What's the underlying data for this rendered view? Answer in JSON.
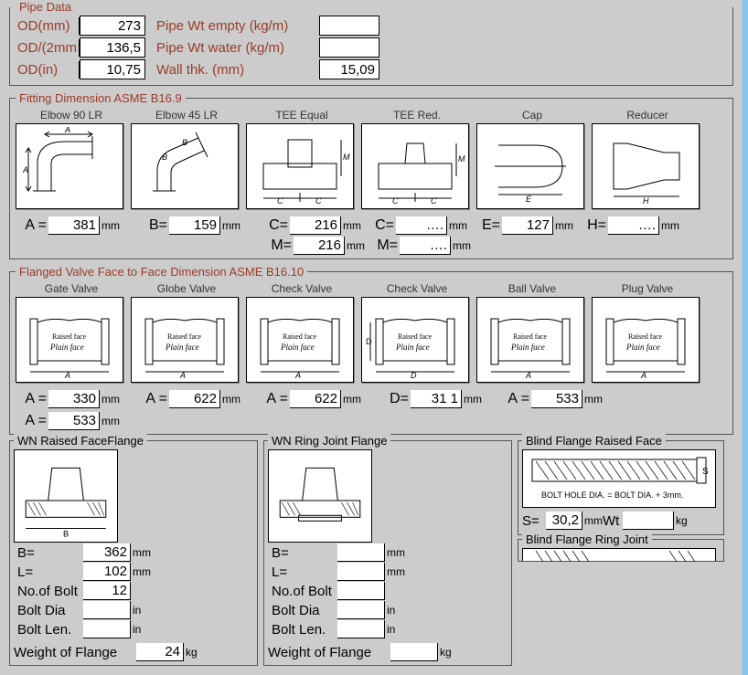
{
  "pipe_data": {
    "legend": "Pipe Data",
    "rows": [
      {
        "label": "OD(mm)",
        "value": "273",
        "desc": "Pipe Wt empty (kg/m)",
        "desc_val": ""
      },
      {
        "label": "OD/(2mm",
        "value": "136,5",
        "desc": "Pipe Wt water (kg/m)",
        "desc_val": ""
      },
      {
        "label": "OD(in)",
        "value": "10,75",
        "desc": "Wall thk. (mm)",
        "desc_val": "15,09"
      }
    ]
  },
  "fitting": {
    "legend": "Fitting Dimension ASME B16.9",
    "items": [
      {
        "caption": "Elbow 90 LR",
        "dims": [
          {
            "l": "A =",
            "v": "381",
            "u": "mm"
          }
        ]
      },
      {
        "caption": "Elbow 45 LR",
        "dims": [
          {
            "l": "B=",
            "v": "159",
            "u": "mm"
          }
        ]
      },
      {
        "caption": "TEE Equal",
        "dims": [
          {
            "l": "C=",
            "v": "216",
            "u": "mm"
          },
          {
            "l": "M=",
            "v": "216",
            "u": "mm"
          }
        ]
      },
      {
        "caption": "TEE Red.",
        "dims": [
          {
            "l": "C=",
            "v": "….",
            "u": "mm"
          },
          {
            "l": "M=",
            "v": "….",
            "u": "mm"
          }
        ]
      },
      {
        "caption": "Cap",
        "dims": [
          {
            "l": "E=",
            "v": "127",
            "u": "mm"
          }
        ]
      },
      {
        "caption": "Reducer",
        "dims": [
          {
            "l": "H=",
            "v": "….",
            "u": "mm"
          }
        ]
      }
    ]
  },
  "valve": {
    "legend": "Flanged Valve Face to Face Dimension ASME B16.10",
    "items": [
      {
        "caption": "Gate Valve",
        "l": "A =",
        "v": "330",
        "u": "mm"
      },
      {
        "caption": "Globe Valve",
        "l": "A =",
        "v": "622",
        "u": "mm"
      },
      {
        "caption": "Check Valve",
        "l": "A =",
        "v": "622",
        "u": "mm"
      },
      {
        "caption": "Check Valve",
        "l": "D=",
        "v": "31 1",
        "u": "mm"
      },
      {
        "caption": "Ball Valve",
        "l": "A =",
        "v": "533",
        "u": "mm"
      },
      {
        "caption": "Plug  Valve",
        "l": "A =",
        "v": "533",
        "u": "mm"
      }
    ]
  },
  "flange_wn_rf": {
    "legend": "WN Raised FaceFlange",
    "fields": [
      {
        "l": "B=",
        "v": "362",
        "u": "mm"
      },
      {
        "l": "L=",
        "v": "102",
        "u": "mm"
      },
      {
        "l": "No.of Bolt",
        "v": "12",
        "u": ""
      },
      {
        "l": "Bolt Dia",
        "v": "",
        "u": "in"
      },
      {
        "l": "Bolt Len.",
        "v": "",
        "u": "in"
      }
    ],
    "weight_label": "Weight of Flange",
    "weight_val": "24",
    "weight_unit": "kg"
  },
  "flange_wn_rj": {
    "legend": "WN Ring Joint Flange",
    "fields": [
      {
        "l": "B=",
        "v": "",
        "u": "mm"
      },
      {
        "l": "L=",
        "v": "",
        "u": "mm"
      },
      {
        "l": "No.of Bolt",
        "v": "",
        "u": ""
      },
      {
        "l": "Bolt Dia",
        "v": "",
        "u": "in"
      },
      {
        "l": "Bolt Len.",
        "v": "",
        "u": "in"
      }
    ],
    "weight_label": "Weight of Flange",
    "weight_val": "",
    "weight_unit": "kg"
  },
  "blind_flange_rf": {
    "legend": "Blind Flange Raised Face",
    "note": "BOLT HOLE DIA. =  BOLT DIA. + 3mm.",
    "s_lbl": "S=",
    "s_val": "30,2",
    "s_unit": "mm",
    "wt_lbl": "Wt",
    "wt_val": "",
    "wt_unit": "kg"
  },
  "blind_flange_rj": {
    "legend": "Blind Flange Ring Joint"
  },
  "text": {
    "raised_face": "Raised face",
    "plain_face": "Plain face"
  }
}
